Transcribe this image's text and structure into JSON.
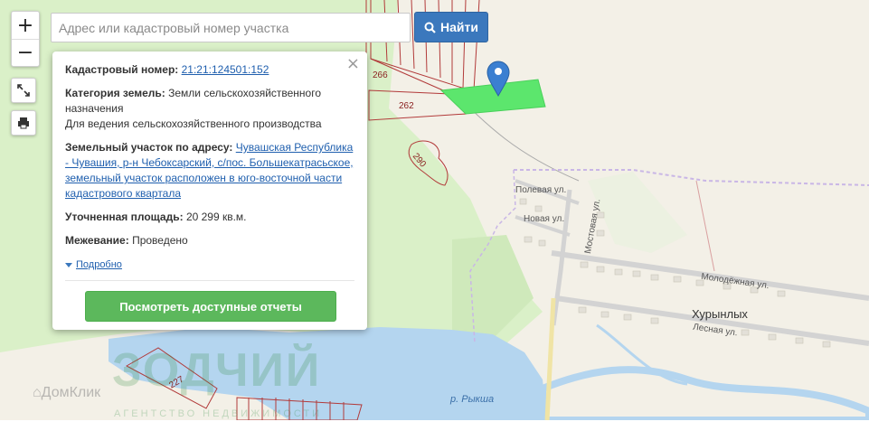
{
  "search": {
    "placeholder": "Адрес или кадастровый номер участка",
    "button_label": "Найти"
  },
  "controls": {
    "zoom_in": "+",
    "zoom_out": "−"
  },
  "popup": {
    "close": "×",
    "cadastral_label": "Кадастровый номер:",
    "cadastral_value": "21:21:124501:152",
    "category_label": "Категория земель:",
    "category_value_1": "Земли сельскохозяйственного назначения",
    "category_value_2": "Для ведения сельскохозяйственного производства",
    "address_label": "Земельный участок по адресу:",
    "address_value": "Чувашская Республика - Чувашия, р-н Чебоксарский, с/пос. Большекатрасьское, земельный участок расположен в юго-восточной части кадастрового квартала",
    "area_label": "Уточненная площадь:",
    "area_value": "20 299 кв.м.",
    "survey_label": "Межевание:",
    "survey_value": "Проведено",
    "more_link": "Подробно",
    "report_button": "Посмотреть доступные отчеты"
  },
  "map": {
    "parcel_numbers": [
      "266",
      "262",
      "290",
      "227"
    ],
    "streets": [
      "Полевая ул.",
      "Новая ул.",
      "Мостовая ул.",
      "Молодёжная ул.",
      "Лесная ул."
    ],
    "village": "Хурынлых",
    "river": "р. Рыкша",
    "colors": {
      "land": "#f3f0e7",
      "forest": "#daf0c8",
      "water": "#b4d5ef",
      "parcel_border": "#b23a3a",
      "selected_parcel": "#5ce66d",
      "marker": "#3b7fd1"
    }
  },
  "watermark": {
    "brand": "ЗОДЧИЙ",
    "tagline": "АГЕНТСТВО НЕДВИЖИМОСТИ",
    "domclick": "ДомКлик"
  }
}
